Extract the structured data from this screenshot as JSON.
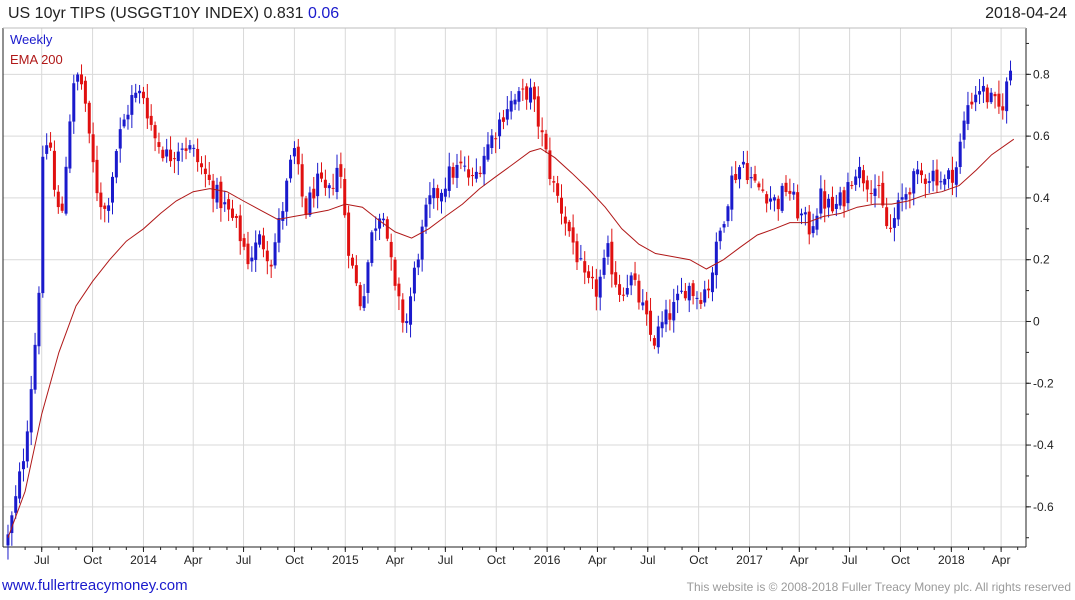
{
  "header": {
    "title": "US 10yr TIPS (USGGT10Y INDEX)",
    "last_value": "0.831",
    "change": "0.06",
    "date": "2018-04-24"
  },
  "footer": {
    "site": "www.fullertreacymoney.com",
    "copyright": "This website is © 2008-2018 Fuller Treacy Money plc. All rights reserved"
  },
  "colors": {
    "up": "#1a1acc",
    "down": "#e01010",
    "ema": "#b01818",
    "grid": "#d9d9d9",
    "site_link": "#1a1acc",
    "change": "#1a1acc"
  },
  "chart_data": {
    "type": "candlestick",
    "frequency": "weekly",
    "x_axis_labels": [
      "Jul",
      "Oct",
      "2014",
      "Apr",
      "Jul",
      "Oct",
      "2015",
      "Apr",
      "Jul",
      "Oct",
      "2016",
      "Apr",
      "Jul",
      "Oct",
      "2017",
      "Apr",
      "Jul",
      "Oct",
      "2018",
      "Apr"
    ],
    "y_ticks": [
      0.8,
      0.6,
      0.4,
      0.2,
      0,
      -0.2,
      -0.4,
      -0.6
    ],
    "y_tick_labels": [
      "0.8",
      "0.6",
      "0.4",
      "0.2",
      "0",
      "-0.2",
      "-0.4",
      "-0.6"
    ],
    "ylim": [
      -0.73,
      0.95
    ],
    "grid": true,
    "legend": [
      {
        "label": "Weekly",
        "color": "#1a1acc"
      },
      {
        "label": "EMA 200",
        "color": "#b01818"
      }
    ],
    "series": [
      {
        "name": "Weekly",
        "close_points": [
          [
            "2013-05-01",
            -0.7
          ],
          [
            "2013-05-15",
            -0.58
          ],
          [
            "2013-06-01",
            -0.4
          ],
          [
            "2013-06-15",
            -0.15
          ],
          [
            "2013-06-25",
            0.05
          ],
          [
            "2013-07-01",
            0.45
          ],
          [
            "2013-07-05",
            0.55
          ],
          [
            "2013-07-15",
            0.6
          ],
          [
            "2013-07-25",
            0.4
          ],
          [
            "2013-08-05",
            0.32
          ],
          [
            "2013-08-20",
            0.65
          ],
          [
            "2013-09-01",
            0.8
          ],
          [
            "2013-09-15",
            0.76
          ],
          [
            "2013-09-25",
            0.58
          ],
          [
            "2013-10-10",
            0.42
          ],
          [
            "2013-10-25",
            0.35
          ],
          [
            "2013-11-15",
            0.58
          ],
          [
            "2013-12-10",
            0.72
          ],
          [
            "2013-12-31",
            0.74
          ],
          [
            "2014-01-20",
            0.6
          ],
          [
            "2014-02-15",
            0.53
          ],
          [
            "2014-03-10",
            0.58
          ],
          [
            "2014-03-31",
            0.55
          ],
          [
            "2014-04-20",
            0.48
          ],
          [
            "2014-05-10",
            0.42
          ],
          [
            "2014-06-01",
            0.36
          ],
          [
            "2014-06-20",
            0.3
          ],
          [
            "2014-07-10",
            0.2
          ],
          [
            "2014-08-01",
            0.27
          ],
          [
            "2014-08-20",
            0.2
          ],
          [
            "2014-09-10",
            0.37
          ],
          [
            "2014-09-30",
            0.56
          ],
          [
            "2014-10-20",
            0.35
          ],
          [
            "2014-11-10",
            0.45
          ],
          [
            "2014-12-01",
            0.4
          ],
          [
            "2014-12-20",
            0.52
          ],
          [
            "2015-01-10",
            0.2
          ],
          [
            "2015-01-30",
            0.05
          ],
          [
            "2015-02-20",
            0.3
          ],
          [
            "2015-03-10",
            0.38
          ],
          [
            "2015-03-31",
            0.1
          ],
          [
            "2015-04-20",
            -0.02
          ],
          [
            "2015-05-10",
            0.2
          ],
          [
            "2015-05-31",
            0.38
          ],
          [
            "2015-06-20",
            0.42
          ],
          [
            "2015-07-10",
            0.48
          ],
          [
            "2015-07-31",
            0.5
          ],
          [
            "2015-08-20",
            0.45
          ],
          [
            "2015-09-10",
            0.55
          ],
          [
            "2015-09-30",
            0.62
          ],
          [
            "2015-10-20",
            0.7
          ],
          [
            "2015-11-10",
            0.72
          ],
          [
            "2015-11-30",
            0.75
          ],
          [
            "2015-12-20",
            0.62
          ],
          [
            "2016-01-10",
            0.45
          ],
          [
            "2016-01-30",
            0.35
          ],
          [
            "2016-02-20",
            0.24
          ],
          [
            "2016-03-10",
            0.12
          ],
          [
            "2016-03-31",
            0.1
          ],
          [
            "2016-04-20",
            0.22
          ],
          [
            "2016-05-10",
            0.1
          ],
          [
            "2016-05-31",
            0.14
          ],
          [
            "2016-06-20",
            0.05
          ],
          [
            "2016-07-10",
            -0.07
          ],
          [
            "2016-07-31",
            0.0
          ],
          [
            "2016-08-20",
            0.05
          ],
          [
            "2016-09-10",
            0.12
          ],
          [
            "2016-09-30",
            0.08
          ],
          [
            "2016-10-20",
            0.12
          ],
          [
            "2016-11-10",
            0.3
          ],
          [
            "2016-11-30",
            0.46
          ],
          [
            "2016-12-20",
            0.52
          ],
          [
            "2017-01-10",
            0.44
          ],
          [
            "2017-01-30",
            0.42
          ],
          [
            "2017-02-20",
            0.38
          ],
          [
            "2017-03-10",
            0.44
          ],
          [
            "2017-03-31",
            0.35
          ],
          [
            "2017-04-20",
            0.3
          ],
          [
            "2017-05-10",
            0.4
          ],
          [
            "2017-05-31",
            0.36
          ],
          [
            "2017-06-20",
            0.4
          ],
          [
            "2017-07-10",
            0.5
          ],
          [
            "2017-07-31",
            0.46
          ],
          [
            "2017-08-20",
            0.43
          ],
          [
            "2017-09-10",
            0.28
          ],
          [
            "2017-09-30",
            0.38
          ],
          [
            "2017-10-20",
            0.45
          ],
          [
            "2017-11-10",
            0.47
          ],
          [
            "2017-11-30",
            0.48
          ],
          [
            "2017-12-20",
            0.45
          ],
          [
            "2018-01-10",
            0.5
          ],
          [
            "2018-01-30",
            0.7
          ],
          [
            "2018-02-20",
            0.76
          ],
          [
            "2018-03-10",
            0.72
          ],
          [
            "2018-03-31",
            0.68
          ],
          [
            "2018-04-20",
            0.83
          ]
        ]
      },
      {
        "name": "EMA 200",
        "points": [
          [
            "2013-05-01",
            -0.7
          ],
          [
            "2013-06-01",
            -0.55
          ],
          [
            "2013-07-01",
            -0.3
          ],
          [
            "2013-08-01",
            -0.1
          ],
          [
            "2013-09-01",
            0.05
          ],
          [
            "2013-10-01",
            0.13
          ],
          [
            "2013-11-01",
            0.2
          ],
          [
            "2013-12-01",
            0.26
          ],
          [
            "2014-01-01",
            0.3
          ],
          [
            "2014-02-01",
            0.35
          ],
          [
            "2014-03-01",
            0.39
          ],
          [
            "2014-04-01",
            0.42
          ],
          [
            "2014-05-01",
            0.43
          ],
          [
            "2014-06-01",
            0.42
          ],
          [
            "2014-07-01",
            0.39
          ],
          [
            "2014-08-01",
            0.36
          ],
          [
            "2014-09-01",
            0.33
          ],
          [
            "2014-10-01",
            0.34
          ],
          [
            "2014-11-01",
            0.35
          ],
          [
            "2014-12-01",
            0.36
          ],
          [
            "2015-01-01",
            0.38
          ],
          [
            "2015-02-01",
            0.37
          ],
          [
            "2015-03-01",
            0.33
          ],
          [
            "2015-04-01",
            0.29
          ],
          [
            "2015-05-01",
            0.27
          ],
          [
            "2015-06-01",
            0.3
          ],
          [
            "2015-07-01",
            0.34
          ],
          [
            "2015-08-01",
            0.38
          ],
          [
            "2015-09-01",
            0.43
          ],
          [
            "2015-10-01",
            0.47
          ],
          [
            "2015-11-01",
            0.51
          ],
          [
            "2015-12-01",
            0.55
          ],
          [
            "2015-12-20",
            0.56
          ],
          [
            "2016-01-15",
            0.53
          ],
          [
            "2016-02-15",
            0.48
          ],
          [
            "2016-03-15",
            0.43
          ],
          [
            "2016-04-15",
            0.37
          ],
          [
            "2016-05-15",
            0.3
          ],
          [
            "2016-06-15",
            0.25
          ],
          [
            "2016-07-15",
            0.22
          ],
          [
            "2016-08-15",
            0.21
          ],
          [
            "2016-09-15",
            0.2
          ],
          [
            "2016-10-15",
            0.17
          ],
          [
            "2016-11-15",
            0.2
          ],
          [
            "2016-12-15",
            0.24
          ],
          [
            "2017-01-15",
            0.28
          ],
          [
            "2017-02-15",
            0.3
          ],
          [
            "2017-03-15",
            0.32
          ],
          [
            "2017-04-15",
            0.32
          ],
          [
            "2017-05-15",
            0.34
          ],
          [
            "2017-06-15",
            0.35
          ],
          [
            "2017-07-15",
            0.37
          ],
          [
            "2017-08-15",
            0.38
          ],
          [
            "2017-09-15",
            0.38
          ],
          [
            "2017-10-15",
            0.39
          ],
          [
            "2017-11-15",
            0.41
          ],
          [
            "2017-12-15",
            0.42
          ],
          [
            "2018-01-15",
            0.44
          ],
          [
            "2018-02-15",
            0.49
          ],
          [
            "2018-03-15",
            0.54
          ],
          [
            "2018-04-24",
            0.59
          ]
        ]
      }
    ]
  }
}
